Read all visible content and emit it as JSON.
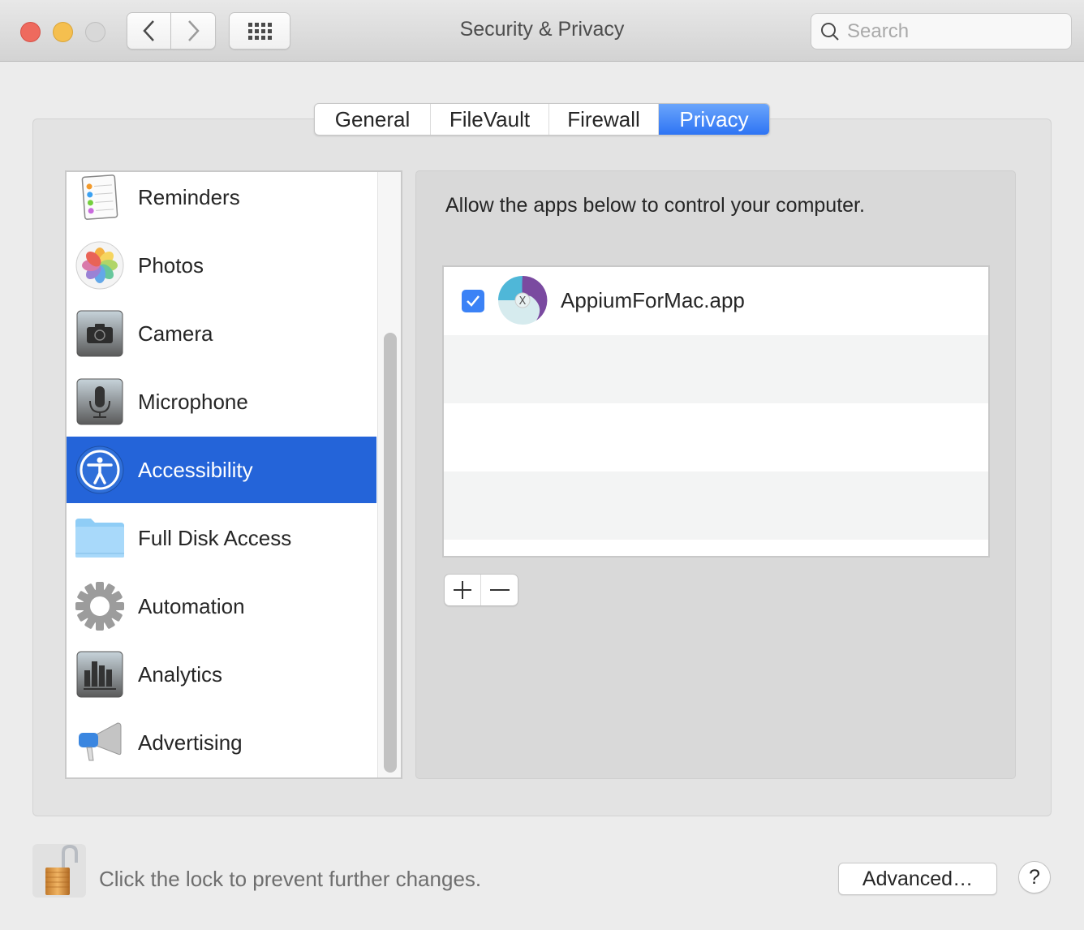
{
  "window": {
    "title": "Security & Privacy",
    "search_placeholder": "Search",
    "search_value": ""
  },
  "tabs": [
    {
      "label": "General",
      "active": false
    },
    {
      "label": "FileVault",
      "active": false
    },
    {
      "label": "Firewall",
      "active": false
    },
    {
      "label": "Privacy",
      "active": true
    }
  ],
  "sidebar": {
    "items": [
      {
        "label": "Reminders",
        "icon": "reminders-icon",
        "selected": false
      },
      {
        "label": "Photos",
        "icon": "photos-icon",
        "selected": false
      },
      {
        "label": "Camera",
        "icon": "camera-icon",
        "selected": false
      },
      {
        "label": "Microphone",
        "icon": "microphone-icon",
        "selected": false
      },
      {
        "label": "Accessibility",
        "icon": "accessibility-icon",
        "selected": true
      },
      {
        "label": "Full Disk Access",
        "icon": "folder-icon",
        "selected": false
      },
      {
        "label": "Automation",
        "icon": "gear-icon",
        "selected": false
      },
      {
        "label": "Analytics",
        "icon": "analytics-icon",
        "selected": false
      },
      {
        "label": "Advertising",
        "icon": "megaphone-icon",
        "selected": false
      }
    ]
  },
  "panel": {
    "heading": "Allow the apps below to control your computer.",
    "apps": [
      {
        "name": "AppiumForMac.app",
        "checked": true
      }
    ],
    "add_label": "+",
    "remove_label": "−"
  },
  "footer": {
    "lock_text": "Click the lock to prevent further changes.",
    "advanced_label": "Advanced…",
    "help_label": "?"
  },
  "colors": {
    "accent": "#2464d9",
    "tab_active": "#3b7cf6",
    "checkbox": "#3b82f6"
  }
}
